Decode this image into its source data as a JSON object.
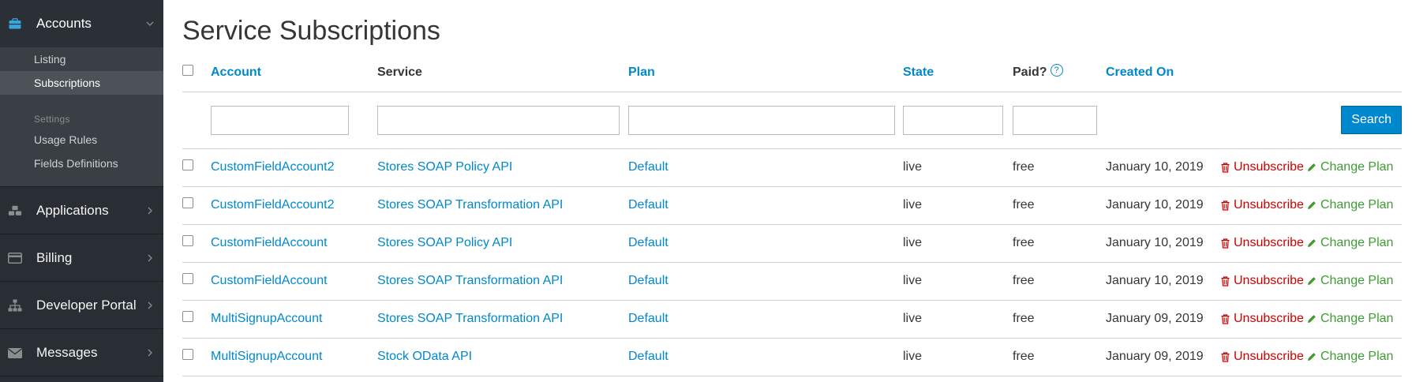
{
  "sidebar": {
    "accounts": {
      "label": "Accounts",
      "icon": "briefcase-icon"
    },
    "subitems": [
      {
        "label": "Listing",
        "active": false
      },
      {
        "label": "Subscriptions",
        "active": true
      }
    ],
    "settings_heading": "Settings",
    "settings_items": [
      {
        "label": "Usage Rules"
      },
      {
        "label": "Fields Definitions"
      }
    ],
    "sections": [
      {
        "label": "Applications",
        "icon": "cubes-icon"
      },
      {
        "label": "Billing",
        "icon": "credit-card-icon"
      },
      {
        "label": "Developer Portal",
        "icon": "sitemap-icon"
      },
      {
        "label": "Messages",
        "icon": "envelope-icon"
      }
    ]
  },
  "page": {
    "title": "Service Subscriptions"
  },
  "table": {
    "headers": {
      "account": "Account",
      "service": "Service",
      "plan": "Plan",
      "state": "State",
      "paid": "Paid?",
      "created_on": "Created On"
    },
    "help_glyph": "?",
    "search_label": "Search",
    "action_labels": {
      "unsubscribe": "Unsubscribe",
      "change_plan": "Change Plan"
    },
    "rows": [
      {
        "account": "CustomFieldAccount2",
        "service": "Stores SOAP Policy API",
        "plan": "Default",
        "state": "live",
        "paid": "free",
        "created_on": "January 10, 2019"
      },
      {
        "account": "CustomFieldAccount2",
        "service": "Stores SOAP Transformation API",
        "plan": "Default",
        "state": "live",
        "paid": "free",
        "created_on": "January 10, 2019"
      },
      {
        "account": "CustomFieldAccount",
        "service": "Stores SOAP Policy API",
        "plan": "Default",
        "state": "live",
        "paid": "free",
        "created_on": "January 10, 2019"
      },
      {
        "account": "CustomFieldAccount",
        "service": "Stores SOAP Transformation API",
        "plan": "Default",
        "state": "live",
        "paid": "free",
        "created_on": "January 10, 2019"
      },
      {
        "account": "MultiSignupAccount",
        "service": "Stores SOAP Transformation API",
        "plan": "Default",
        "state": "live",
        "paid": "free",
        "created_on": "January 09, 2019"
      },
      {
        "account": "MultiSignupAccount",
        "service": "Stock OData API",
        "plan": "Default",
        "state": "live",
        "paid": "free",
        "created_on": "January 09, 2019"
      }
    ]
  },
  "colors": {
    "link": "#0088ce",
    "danger": "#cc0000",
    "success": "#3f9c35",
    "sidebar_bg": "#292e34"
  }
}
